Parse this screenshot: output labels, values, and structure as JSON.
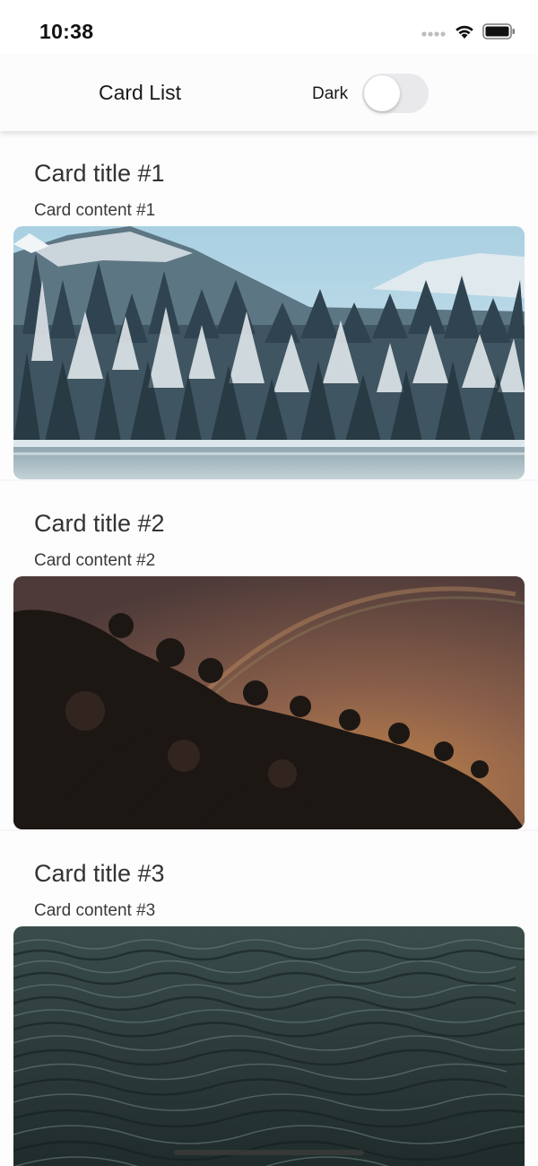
{
  "status_bar": {
    "time": "10:38",
    "icons": [
      "signal-dots-icon",
      "wifi-icon",
      "battery-icon"
    ]
  },
  "nav": {
    "title": "Card List",
    "theme_label": "Dark",
    "theme_toggle": false
  },
  "cards": [
    {
      "title": "Card title #1",
      "content": "Card content #1",
      "image": "snowy-forest-lake"
    },
    {
      "title": "Card title #2",
      "content": "Card content #2",
      "image": "tree-silhouette-rainbow-sunset"
    },
    {
      "title": "Card title #3",
      "content": "Card content #3",
      "image": "dark-ocean-waves"
    }
  ],
  "colors": {
    "background": "#f6f6f8",
    "card": "#fdfdfe",
    "toggle_off": "#e9e9ec",
    "title_text": "#333333"
  }
}
